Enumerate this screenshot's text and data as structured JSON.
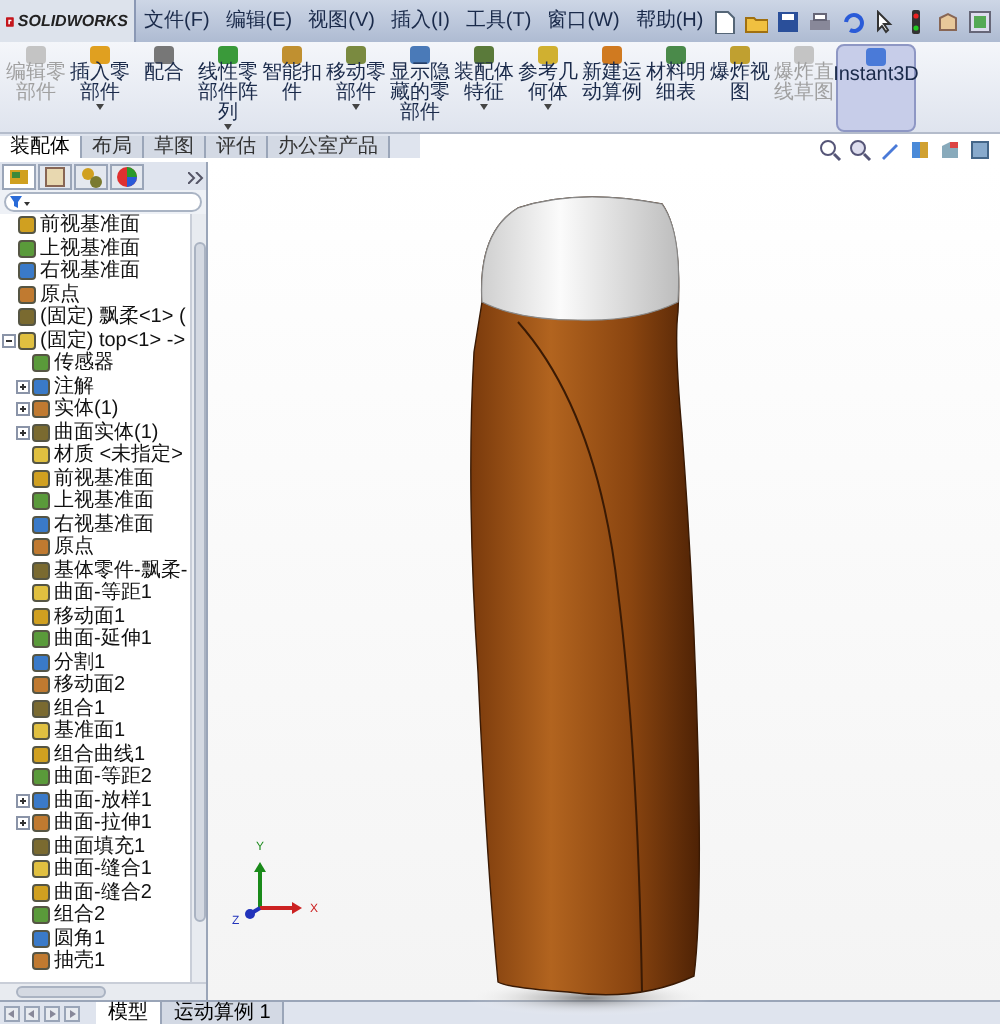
{
  "app": {
    "logo": "SOLIDWORKS"
  },
  "menu": [
    "文件(F)",
    "编辑(E)",
    "视图(V)",
    "插入(I)",
    "工具(T)",
    "窗口(W)",
    "帮助(H)"
  ],
  "ribbon": [
    {
      "label": "编辑零部件",
      "disabled": true,
      "dropdown": false,
      "selected": false
    },
    {
      "label": "插入零部件",
      "disabled": false,
      "dropdown": true,
      "selected": false
    },
    {
      "label": "配合",
      "disabled": false,
      "dropdown": false,
      "selected": false
    },
    {
      "label": "线性零部件阵列",
      "disabled": false,
      "dropdown": true,
      "selected": false
    },
    {
      "label": "智能扣件",
      "disabled": false,
      "dropdown": false,
      "selected": false
    },
    {
      "label": "移动零部件",
      "disabled": false,
      "dropdown": true,
      "selected": false
    },
    {
      "label": "显示隐藏的零部件",
      "disabled": false,
      "dropdown": false,
      "selected": false
    },
    {
      "label": "装配体特征",
      "disabled": false,
      "dropdown": true,
      "selected": false
    },
    {
      "label": "参考几何体",
      "disabled": false,
      "dropdown": true,
      "selected": false
    },
    {
      "label": "新建运动算例",
      "disabled": false,
      "dropdown": false,
      "selected": false
    },
    {
      "label": "材料明细表",
      "disabled": false,
      "dropdown": false,
      "selected": false
    },
    {
      "label": "爆炸视图",
      "disabled": false,
      "dropdown": false,
      "selected": false
    },
    {
      "label": "爆炸直线草图",
      "disabled": true,
      "dropdown": false,
      "selected": false
    },
    {
      "label": "Instant3D",
      "disabled": false,
      "dropdown": false,
      "selected": true
    }
  ],
  "command_tabs": [
    {
      "label": "装配体",
      "selected": true
    },
    {
      "label": "布局",
      "selected": false
    },
    {
      "label": "草图",
      "selected": false
    },
    {
      "label": "评估",
      "selected": false
    },
    {
      "label": "办公室产品",
      "selected": false
    }
  ],
  "tree": [
    {
      "label": "前视基准面"
    },
    {
      "label": "上视基准面"
    },
    {
      "label": "右视基准面"
    },
    {
      "label": "原点"
    },
    {
      "label": "(固定) 飘柔<1> ("
    },
    {
      "label": "(固定) top<1> ->",
      "expanded": true,
      "children": [
        {
          "label": "传感器"
        },
        {
          "label": "注解",
          "expanded": false
        },
        {
          "label": "实体(1)",
          "expanded": false
        },
        {
          "label": "曲面实体(1)",
          "expanded": false
        },
        {
          "label": "材质 <未指定>"
        },
        {
          "label": "前视基准面"
        },
        {
          "label": "上视基准面"
        },
        {
          "label": "右视基准面"
        },
        {
          "label": "原点"
        },
        {
          "label": "基体零件-飘柔-"
        },
        {
          "label": "曲面-等距1"
        },
        {
          "label": "移动面1"
        },
        {
          "label": "曲面-延伸1"
        },
        {
          "label": "分割1"
        },
        {
          "label": "移动面2"
        },
        {
          "label": "组合1"
        },
        {
          "label": "基准面1"
        },
        {
          "label": "组合曲线1"
        },
        {
          "label": "曲面-等距2"
        },
        {
          "label": "曲面-放样1",
          "expanded": false
        },
        {
          "label": "曲面-拉伸1",
          "expanded": false
        },
        {
          "label": "曲面填充1"
        },
        {
          "label": "曲面-缝合1"
        },
        {
          "label": "曲面-缝合2"
        },
        {
          "label": "组合2"
        },
        {
          "label": "圆角1"
        },
        {
          "label": "抽壳1"
        }
      ]
    }
  ],
  "panel_tabs": [
    {
      "selected": true
    },
    {
      "selected": false
    },
    {
      "selected": false
    },
    {
      "selected": false
    }
  ],
  "triad": {
    "y": "Y",
    "x": "X",
    "z": "Z"
  },
  "bottom_tabs": [
    {
      "label": "模型",
      "selected": true
    },
    {
      "label": "运动算例 1",
      "selected": false
    }
  ]
}
